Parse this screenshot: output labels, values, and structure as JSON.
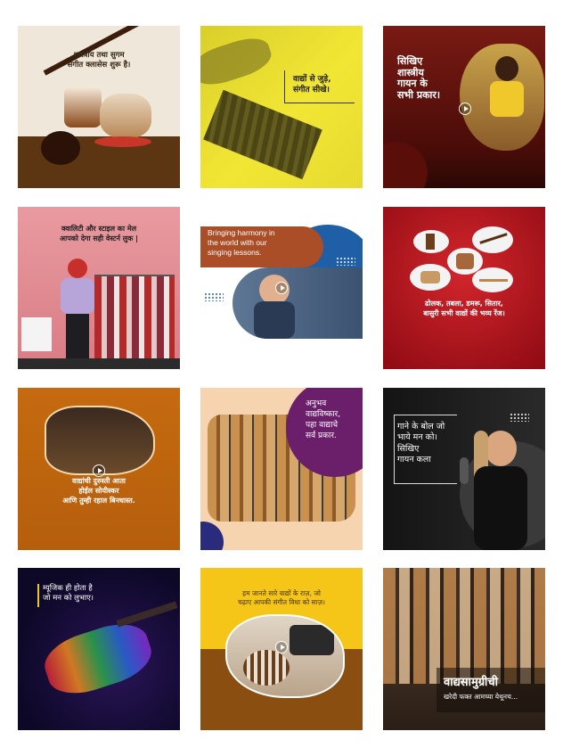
{
  "tiles": [
    {
      "id": "classical-classes",
      "text": "शास्त्रीय तथा सुगम\nसंगीत क्लासेस शुरू है।"
    },
    {
      "id": "join-instruments",
      "text": "वाद्यों से जुड़े,\nसंगीत सीखे।"
    },
    {
      "id": "learn-singing",
      "text": "सिखिए\nशास्त्रीय\nगायन के\nसभी प्रकार।"
    },
    {
      "id": "western-look",
      "text": "क्वालिटी और स्टाइल का मेल\nआपको देगा सही वेस्टर्न लुक |"
    },
    {
      "id": "harmony-lessons",
      "text": "Bringing harmony in\nthe world with our\nsinging lessons."
    },
    {
      "id": "instrument-range",
      "text": "ढोलक, तबला, डमरू, सितार,\nबासुरी  सभी वाद्यों की भव्य रेंज।"
    },
    {
      "id": "instrument-shop",
      "text": "वाद्यांची दुरुस्ती आता\nहोईल सोयीस्कर\nआणि तुम्ही रहाल बिनधास्त."
    },
    {
      "id": "instrument-types",
      "text": "अनुभव\nवाद्यविष्कार,\nपहा वाद्याचे\nसर्व प्रकार."
    },
    {
      "id": "song-lyrics",
      "text": "गाने के बोल जो\nभाये मन को।\nसिखिए\nगायन कला"
    },
    {
      "id": "music-heart",
      "text": "म्यूजिक ही होता है\nजो मन को लुभाए।"
    },
    {
      "id": "music-secrets",
      "text": "हम जानते सारे वाद्यों के राज़, जो\nचढ़ाए आपकी संगीत विधा को साज़।"
    },
    {
      "id": "instrument-buy",
      "title": "वाद्यसामुग्रीची",
      "text": "खरेदी फक्त आमच्या येथूनच..."
    }
  ],
  "colors": {
    "cream": "#efe7d9",
    "yellow": "#f2e634",
    "maroon": "#6b1410",
    "pink": "#e8939a",
    "red": "#b3111a",
    "orange": "#c4680f",
    "purple": "#6b1f6b",
    "dark": "#1c1c1c"
  }
}
